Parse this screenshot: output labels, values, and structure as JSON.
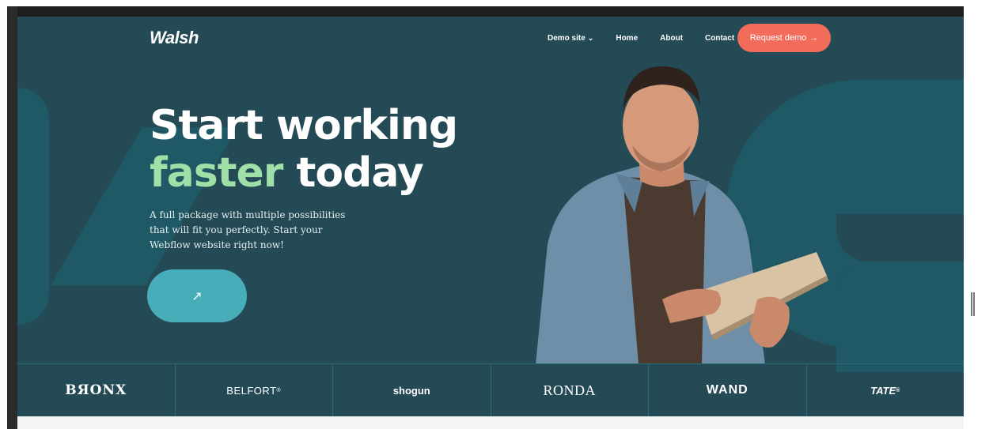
{
  "nav": {
    "logo": "Walsh",
    "links": [
      {
        "label": "Demo site",
        "has_dropdown": true
      },
      {
        "label": "Home"
      },
      {
        "label": "About"
      },
      {
        "label": "Contact"
      }
    ],
    "cta_label": "Request demo",
    "cta_icon": "arrow-right-icon"
  },
  "hero": {
    "headline_line1": "Start working",
    "headline_accent": "faster",
    "headline_rest": " today",
    "subtext": "A full package with multiple possibilities that will fit you perfectly. Start your Webflow website right now!",
    "button_icon": "arrow-up-right-icon",
    "image_alt": "man holding tablet"
  },
  "brands": [
    {
      "name": "BЯONX"
    },
    {
      "name": "BELFORT",
      "mark": "®"
    },
    {
      "name": "shogun"
    },
    {
      "name": "RONDA"
    },
    {
      "name": "WAND"
    },
    {
      "name": "TATE",
      "mark": "®"
    }
  ],
  "colors": {
    "background": "#234a55",
    "shape": "#1f5966",
    "accent_green": "#9ee0a8",
    "cta": "#f36b5b",
    "hero_button": "#47adb8"
  }
}
